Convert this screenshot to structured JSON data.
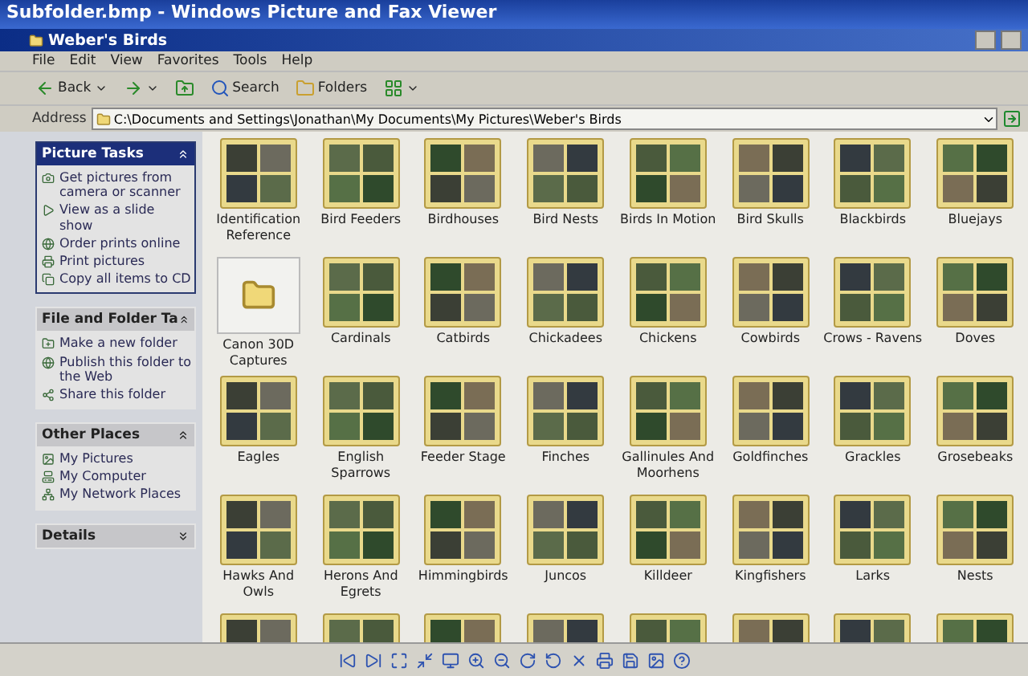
{
  "viewer": {
    "title": "Subfolder.bmp - Windows Picture and Fax Viewer"
  },
  "window": {
    "title": "Weber's Birds"
  },
  "menu": [
    "File",
    "Edit",
    "View",
    "Favorites",
    "Tools",
    "Help"
  ],
  "toolbar": [
    {
      "kind": "back",
      "label": "Back"
    },
    {
      "kind": "forward"
    },
    {
      "kind": "up"
    },
    {
      "kind": "search",
      "label": "Search"
    },
    {
      "kind": "folders",
      "label": "Folders"
    },
    {
      "kind": "views"
    }
  ],
  "address": {
    "label": "Address",
    "value": "C:\\Documents and Settings\\Jonathan\\My Documents\\My Pictures\\Weber's Birds"
  },
  "sidebar": [
    {
      "title": "Picture Tasks",
      "kind": "special",
      "items": [
        "Get pictures from camera or scanner",
        "View as a slide show",
        "Order prints online",
        "Print pictures",
        "Copy all items to CD"
      ]
    },
    {
      "title": "File and Folder Ta",
      "kind": "normal",
      "items": [
        "Make a new folder",
        "Publish this folder to the Web",
        "Share this folder"
      ]
    },
    {
      "title": "Other Places",
      "kind": "normal",
      "items": [
        "My Pictures",
        "My Computer",
        "My Network Places"
      ]
    },
    {
      "title": "Details",
      "kind": "collapsed"
    }
  ],
  "folders": [
    {
      "kind": "thumbs",
      "label": "Identification Reference"
    },
    {
      "kind": "thumbs",
      "label": "Bird Feeders"
    },
    {
      "kind": "thumbs",
      "label": "Birdhouses"
    },
    {
      "kind": "thumbs",
      "label": "Bird Nests"
    },
    {
      "kind": "thumbs",
      "label": "Birds In Motion"
    },
    {
      "kind": "thumbs",
      "label": "Bird Skulls"
    },
    {
      "kind": "thumbs",
      "label": "Blackbirds"
    },
    {
      "kind": "thumbs",
      "label": "Bluejays"
    },
    {
      "kind": "empty",
      "label": "Canon 30D Captures"
    },
    {
      "kind": "thumbs",
      "label": "Cardinals"
    },
    {
      "kind": "thumbs",
      "label": "Catbirds"
    },
    {
      "kind": "thumbs",
      "label": "Chickadees"
    },
    {
      "kind": "thumbs",
      "label": "Chickens"
    },
    {
      "kind": "thumbs",
      "label": "Cowbirds"
    },
    {
      "kind": "thumbs",
      "label": "Crows - Ravens"
    },
    {
      "kind": "thumbs",
      "label": "Doves"
    },
    {
      "kind": "thumbs",
      "label": "Eagles"
    },
    {
      "kind": "thumbs",
      "label": "English Sparrows"
    },
    {
      "kind": "thumbs",
      "label": "Feeder Stage"
    },
    {
      "kind": "thumbs",
      "label": "Finches"
    },
    {
      "kind": "thumbs",
      "label": "Gallinules And Moorhens"
    },
    {
      "kind": "thumbs",
      "label": "Goldfinches"
    },
    {
      "kind": "thumbs",
      "label": "Grackles"
    },
    {
      "kind": "thumbs",
      "label": "Grosebeaks"
    },
    {
      "kind": "thumbs",
      "label": "Hawks And Owls"
    },
    {
      "kind": "thumbs",
      "label": "Herons And Egrets"
    },
    {
      "kind": "thumbs",
      "label": "Himmingbirds"
    },
    {
      "kind": "thumbs",
      "label": "Juncos"
    },
    {
      "kind": "thumbs",
      "label": "Killdeer"
    },
    {
      "kind": "thumbs",
      "label": "Kingfishers"
    },
    {
      "kind": "thumbs",
      "label": "Larks"
    },
    {
      "kind": "thumbs",
      "label": "Nests"
    },
    {
      "kind": "thumbs"
    },
    {
      "kind": "thumbs"
    },
    {
      "kind": "thumbs"
    },
    {
      "kind": "thumbs"
    },
    {
      "kind": "thumbs"
    },
    {
      "kind": "thumbs"
    },
    {
      "kind": "thumbs"
    },
    {
      "kind": "thumbs"
    }
  ]
}
